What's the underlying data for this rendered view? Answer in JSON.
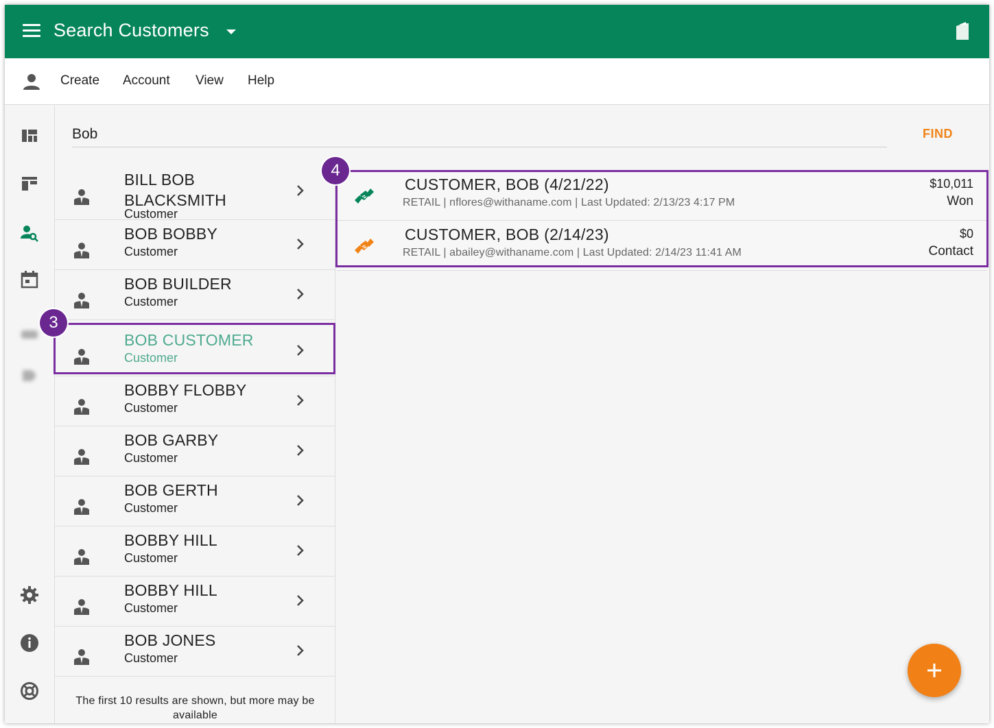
{
  "header": {
    "title": "Search Customers",
    "background": "#06855a"
  },
  "menu": {
    "items": [
      "Create",
      "Account",
      "View",
      "Help"
    ]
  },
  "search": {
    "value": "Bob",
    "find_label": "FIND"
  },
  "results": [
    {
      "name": "BILL BOB BLACKSMITH",
      "type": "Customer",
      "selected": false
    },
    {
      "name": "BOB BOBBY",
      "type": "Customer",
      "selected": false
    },
    {
      "name": "BOB BUILDER",
      "type": "Customer",
      "selected": false
    },
    {
      "name": "BOB CUSTOMER",
      "type": "Customer",
      "selected": true
    },
    {
      "name": "BOBBY FLOBBY",
      "type": "Customer",
      "selected": false
    },
    {
      "name": "BOB GARBY",
      "type": "Customer",
      "selected": false
    },
    {
      "name": "BOB GERTH",
      "type": "Customer",
      "selected": false
    },
    {
      "name": "BOBBY HILL",
      "type": "Customer",
      "selected": false
    },
    {
      "name": "BOBBY HILL",
      "type": "Customer",
      "selected": false
    },
    {
      "name": "BOB JONES",
      "type": "Customer",
      "selected": false
    }
  ],
  "results_note": "The first 10 results are shown, but more may be available",
  "opportunities": [
    {
      "title": "CUSTOMER, BOB (4/21/22)",
      "meta": "RETAIL | nflores@withaname.com | Last Updated: 2/13/23 4:17 PM",
      "amount": "$10,011",
      "status": "Won",
      "icon_color": "#06855a"
    },
    {
      "title": "CUSTOMER, BOB (2/14/23)",
      "meta": "RETAIL | abailey@withaname.com | Last Updated: 2/14/23 11:41 AM",
      "amount": "$0",
      "status": "Contact",
      "icon_color": "#f08417"
    }
  ],
  "callouts": [
    "3",
    "4"
  ],
  "colors": {
    "accent_orange": "#f08417",
    "selected_teal": "#4faa8f",
    "callout_purple": "#6a2790"
  }
}
